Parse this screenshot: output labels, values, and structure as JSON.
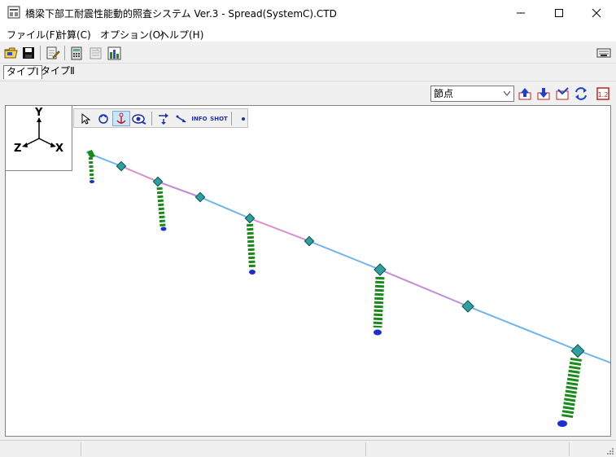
{
  "window": {
    "title": "橋梁下部工耐震性能動的照査システム Ver.3 - Spread(SystemC).CTD",
    "minimize_icon": "minimize-icon",
    "maximize_icon": "maximize-icon",
    "close_icon": "close-icon"
  },
  "menu": [
    {
      "label": "ファイル(F)"
    },
    {
      "label": "計算(C)"
    },
    {
      "label": "オプション(O)"
    },
    {
      "label": "ヘルプ(H)"
    }
  ],
  "toolbar": {
    "icons": [
      "open-folder-icon",
      "save-icon",
      "edit-document-icon",
      "calculator-icon",
      "report-icon",
      "chart-icon",
      "keyboard-icon"
    ]
  },
  "tabs": [
    {
      "label": "タイプⅠ",
      "active": true
    },
    {
      "label": "タイプⅡ",
      "active": false
    }
  ],
  "view_select": {
    "selected": "節点"
  },
  "viewport": {
    "axes": {
      "y": "Y",
      "z": "Z",
      "x": "X"
    },
    "tools": {
      "info_label": "INFO",
      "shot_label": "SHOT"
    }
  },
  "colors": {
    "deck_blue": "#6fb4ef",
    "deck_pink": "#d98cc8",
    "pier_green": "#1a8a1a",
    "node_teal": "#2fa0a0",
    "base_blue": "#1a2fd0"
  }
}
